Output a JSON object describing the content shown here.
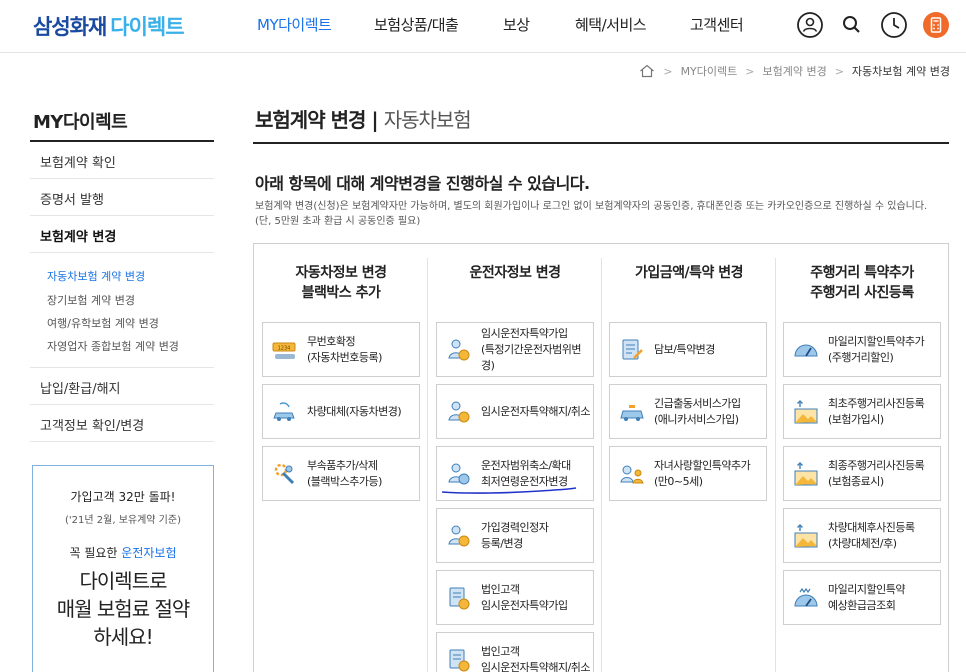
{
  "header": {
    "logo_main": "삼성화재",
    "logo_sub": "다이렉트",
    "nav": [
      "MY다이렉트",
      "보험상품/대출",
      "보상",
      "혜택/서비스",
      "고객센터"
    ],
    "icons": [
      "user-icon",
      "search-icon",
      "clock-icon",
      "calculator-icon"
    ]
  },
  "breadcrumb": {
    "items": [
      "MY다이렉트",
      "보험계약 변경",
      "자동차보험 계약 변경"
    ]
  },
  "sidebar": {
    "title": "MY다이렉트",
    "items": [
      "보험계약 확인",
      "증명서 발행",
      "보험계약 변경"
    ],
    "subitems": [
      "자동차보험 계약 변경",
      "장기보험 계약 변경",
      "여행/유학보험 계약 변경",
      "자영업자 종합보험 계약 변경"
    ],
    "items_after": [
      "납입/환급/해지",
      "고객정보 확인/변경"
    ],
    "promo": {
      "line1": "가입고객 32만 돌파!",
      "line2": "('21년 2월, 보유계약 기준)",
      "line3_prefix": "꼭 필요한 ",
      "line3_highlight": "운전자보험",
      "line4": "다이렉트로",
      "line5": "매월 보험료 절약",
      "line6": "하세요!"
    }
  },
  "main": {
    "title": "보험계약 변경",
    "subtitle": "자동차보험",
    "lead": "아래 항목에 대해 계약변경을 진행하실 수 있습니다.",
    "desc": "보험계약 변경(신청)은 보험계약자만 가능하며, 별도의 회원가입이나 로그인 없이 보험계약자의 공동인증, 휴대폰인증 또는 카카오인증으로 진행하실 수 있습니다. (단, 5만원 초과 환급 시 공동인증 필요)",
    "columns": [
      {
        "head1": "자동차정보 변경",
        "head2": "블랙박스 추가",
        "cards": [
          {
            "l1": "무번호확정",
            "l2": "(자동차번호등록)",
            "icon": "license-plate-icon"
          },
          {
            "l1": "차량대체(자동차변경)",
            "l2": "",
            "icon": "car-replace-icon"
          },
          {
            "l1": "부속품추가/삭제",
            "l2": "(블랙박스추가등)",
            "icon": "car-parts-icon"
          }
        ]
      },
      {
        "head1": "운전자정보 변경",
        "head2": "",
        "cards": [
          {
            "l1": "임시운전자특약가입",
            "l2": "(특정기간운전자범위변경)",
            "icon": "temp-driver-add-icon"
          },
          {
            "l1": "임시운전자특약해지/취소",
            "l2": "",
            "icon": "temp-driver-cancel-icon"
          },
          {
            "l1": "운전자범위축소/확대",
            "l2": "최저연령운전자변경",
            "icon": "driver-range-icon"
          },
          {
            "l1": "가입경력인정자",
            "l2": "등록/변경",
            "icon": "career-driver-icon"
          },
          {
            "l1": "법인고객",
            "l2": "임시운전자특약가입",
            "icon": "corporate-add-icon"
          },
          {
            "l1": "법인고객",
            "l2": "임시운전자특약해지/취소",
            "icon": "corporate-cancel-icon"
          }
        ]
      },
      {
        "head1": "가입금액/특약 변경",
        "head2": "",
        "cards": [
          {
            "l1": "담보/특약변경",
            "l2": "",
            "icon": "coverage-doc-icon"
          },
          {
            "l1": "긴급출동서비스가입",
            "l2": "(애니카서비스가입)",
            "icon": "emergency-car-icon"
          },
          {
            "l1": "자녀사랑할인특약추가",
            "l2": "(만0~5세)",
            "icon": "child-discount-icon"
          }
        ]
      },
      {
        "head1": "주행거리 특약추가",
        "head2": "주행거리 사진등록",
        "cards": [
          {
            "l1": "마일리지할인특약추가",
            "l2": "(주행거리할인)",
            "icon": "gauge-icon"
          },
          {
            "l1": "최초주행거리사진등록",
            "l2": "(보험가입시)",
            "icon": "photo-upload-icon"
          },
          {
            "l1": "최종주행거리사진등록",
            "l2": "(보험종료시)",
            "icon": "photo-upload-icon"
          },
          {
            "l1": "차량대체후사진등록",
            "l2": "(차량대체전/후)",
            "icon": "photo-upload-icon"
          },
          {
            "l1": "마일리지할인특약",
            "l2": "예상환급금조회",
            "icon": "mileage-refund-icon"
          }
        ]
      }
    ]
  }
}
